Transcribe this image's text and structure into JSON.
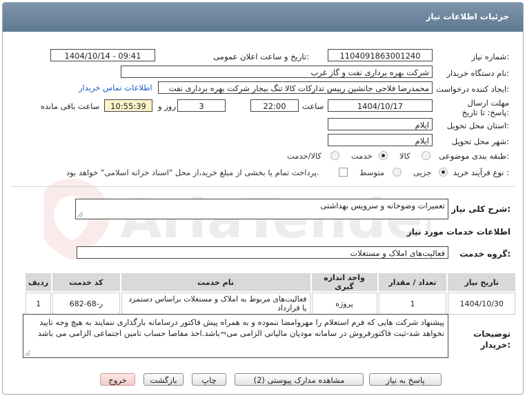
{
  "title": "جزئیات اطلاعات نیاز",
  "fields": {
    "need_number_label": "شماره نیاز:",
    "need_number": "1104091863001240",
    "announce_label": "تاریخ و ساعت اعلان عمومی:",
    "announce_value": "1404/10/14 - 09:41",
    "buyer_org_label": "نام دستگاه خریدار:",
    "buyer_org": "شرکت بهره برداری نفت و گاز غرب",
    "creator_label": "ایجاد کننده درخواست:",
    "creator": "محمدرضا فلاحی جانشین رییس تدارکات کالا تنگ بیجار شرکت بهره برداری نفت",
    "contact_link": "اطلاعات تماس خریدار",
    "deadline_label": "مهلت ارسال پاسخ: تا تاریخ:",
    "deadline_date": "1404/10/17",
    "time_label": "ساعت",
    "deadline_time": "22:00",
    "days_value": "3",
    "days_label": "روز و",
    "remaining_time": "10:55:39",
    "remaining_label": "ساعت باقی مانده",
    "province_label": "استان محل تحویل:",
    "province": "ایلام",
    "city_label": "شهر محل تحویل:",
    "city": "ایلام",
    "category_label": "طبقه بندی موضوعی:",
    "category_options": [
      "کالا",
      "خدمت",
      "کالا/خدمت"
    ],
    "category_selected": "خدمت",
    "process_label": "نوع فرآیند خرید :",
    "process_options": [
      "جزیی",
      "متوسط"
    ],
    "process_selected": "جزیی",
    "payment_text": "پرداخت تمام یا بخشی از مبلغ خرید،از محل \"اسناد خزانه اسلامی\" خواهد بود."
  },
  "description": {
    "label": "شرح کلی نیاز:",
    "value": "تعمیرات وضوخانه و سرویس بهداشتی"
  },
  "services_section_title": "اطلاعات خدمات مورد نیاز",
  "service_group": {
    "label": "گروه خدمت:",
    "value": "فعالیت‌های  املاک و مستغلات"
  },
  "table": {
    "headers": [
      "ردیف",
      "کد خدمت",
      "نام خدمت",
      "واحد اندازه گیری",
      "تعداد / مقدار",
      "تاریخ نیاز"
    ],
    "rows": [
      [
        "1",
        "ر-68-682",
        "فعالیت‌های مربوط به املاک و مستغلات براساس دستمزد یا قرارداد",
        "پروژه",
        "1",
        "1404/10/30"
      ]
    ]
  },
  "buyer_notes": {
    "label": "توضیحات خریدار:",
    "value": "پیشنهاد شرکت هایی که فرم استعلام را مهروامضا ننموده و به همراه پیش فاکتور درسامانه بارگذاری ننمایند به هیچ وجه تایید نخواهد شد-ثبت فاکتورفروش در سامانه مودیان مالیاتی الزامی می¬باشد.اخذ مفاصا حساب تامین اجتماعی الزامی می باشد"
  },
  "buttons": {
    "respond": "پاسخ به نیاز",
    "attachments": "مشاهده مدارک پیوستی (2)",
    "print": "چاپ",
    "back": "بازگشت",
    "exit": "خروج"
  },
  "watermark": "AriaTender.neT",
  "colors": {
    "titlebar": "#6b849c",
    "link": "#1a5fbf",
    "remaining_bg": "#fbf3c7",
    "exit_bg": "#f4c9c9"
  }
}
